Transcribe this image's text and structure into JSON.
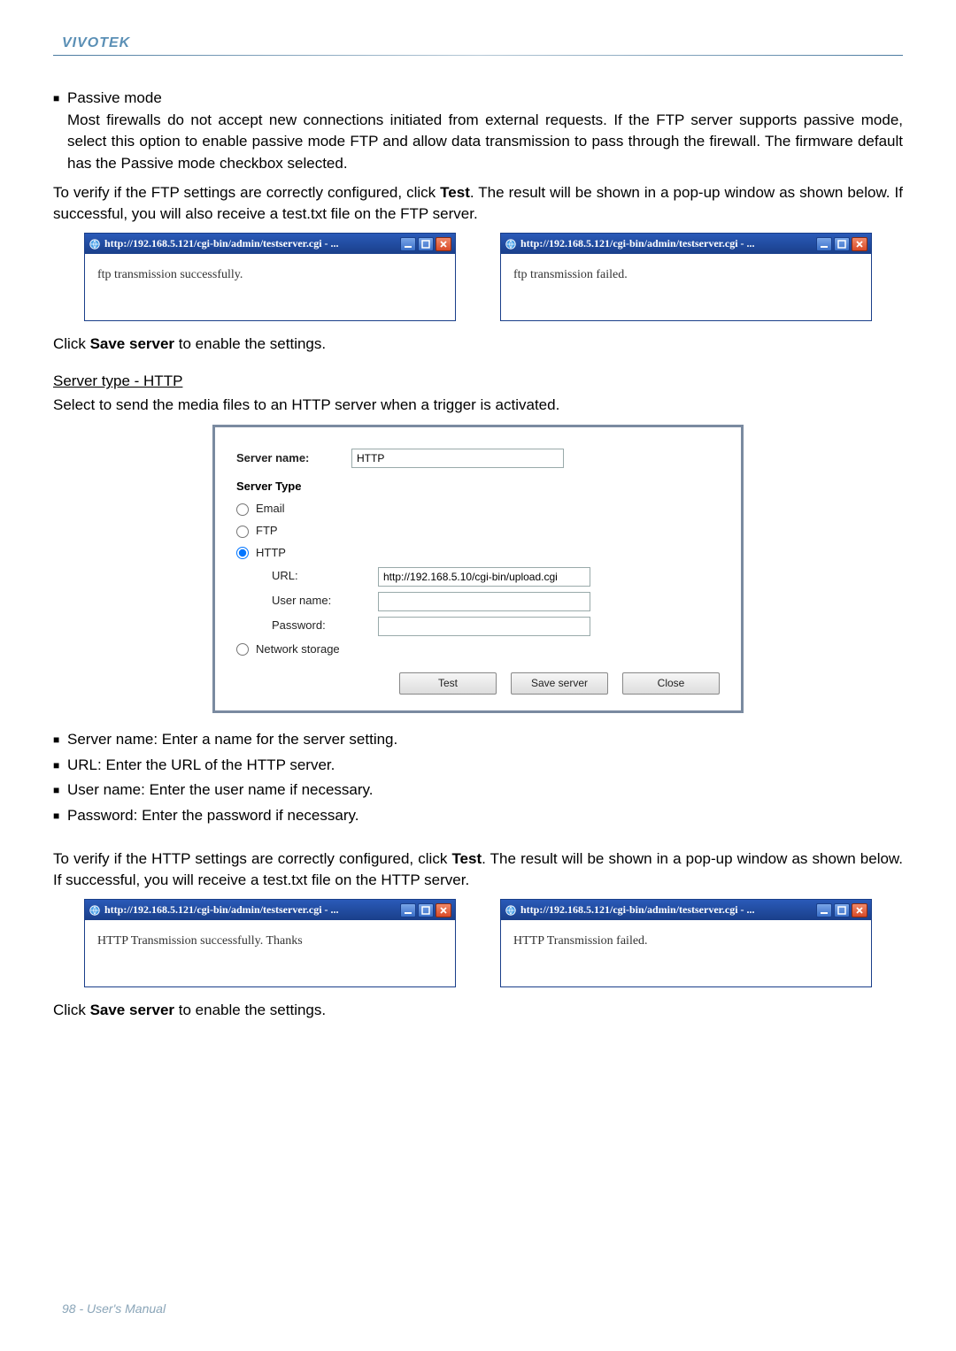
{
  "brand": "VIVOTEK",
  "passive_mode_heading": "Passive mode",
  "passive_mode_paragraph": "Most firewalls do not accept new connections initiated from external requests. If the FTP server supports passive mode, select this option to enable passive mode FTP and allow data transmission to pass through the firewall. The firmware default has the Passive mode checkbox selected.",
  "verify_ftp_pre": "To verify if the FTP settings are correctly configured, click ",
  "test_word": "Test",
  "verify_ftp_post": ". The result will be shown in a pop-up window as shown below. If successful, you will also receive a test.txt file on the FTP server.",
  "popup_ftp": {
    "title": "http://192.168.5.121/cgi-bin/admin/testserver.cgi - ...",
    "success_body": "ftp transmission successfully.",
    "fail_body": "ftp transmission failed."
  },
  "save_server_pre": "Click ",
  "save_server_bold": "Save server",
  "save_server_post": " to enable the settings.",
  "server_type_http_heading": "Server type - HTTP",
  "server_type_http_desc": "Select to send the media files to an HTTP server when a trigger is activated.",
  "cfg": {
    "server_name_label": "Server name:",
    "server_name_value": "HTTP",
    "server_type_heading": "Server Type",
    "radio_email": "Email",
    "radio_ftp": "FTP",
    "radio_http": "HTTP",
    "radio_network_storage": "Network storage",
    "url_label": "URL:",
    "url_value": "http://192.168.5.10/cgi-bin/upload.cgi",
    "username_label": "User name:",
    "username_value": "",
    "password_label": "Password:",
    "password_value": "",
    "btn_test": "Test",
    "btn_save": "Save server",
    "btn_close": "Close"
  },
  "bullets": {
    "server_name": "Server name: Enter a name for the server setting.",
    "url": "URL: Enter the URL of the HTTP server.",
    "username": "User name: Enter the user name if necessary.",
    "password": "Password: Enter the password if necessary."
  },
  "verify_http_pre": "To verify if the HTTP settings are correctly configured, click ",
  "verify_http_post": ". The result will be shown in a pop-up window as shown below. If successful, you will receive a test.txt file on the HTTP server.",
  "popup_http": {
    "title": "http://192.168.5.121/cgi-bin/admin/testserver.cgi - ...",
    "success_body": "HTTP Transmission successfully. Thanks",
    "fail_body": "HTTP Transmission failed."
  },
  "footer": "98 - User's Manual"
}
